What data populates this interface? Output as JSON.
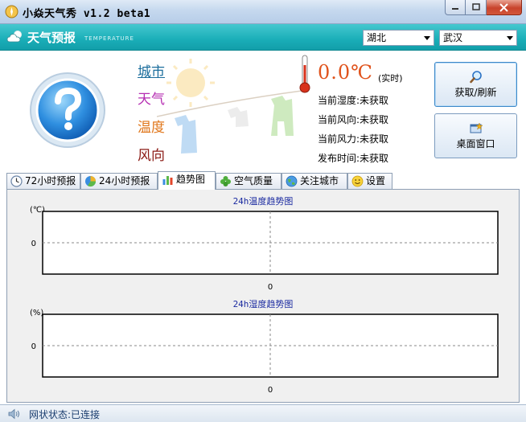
{
  "window": {
    "title": "小焱天气秀 v1.2 beta1",
    "icons": [
      "app-logo-icon",
      "minimize-icon",
      "maximize-icon",
      "close-icon"
    ]
  },
  "header": {
    "title": "天气预报",
    "subtitle": "TEMPERATURE",
    "province": "湖北",
    "city": "武汉"
  },
  "weather": {
    "labels": {
      "city": "城市",
      "weather": "天气",
      "temperature": "温度",
      "wind": "风向"
    },
    "temperature_value": "0.0℃",
    "realtime_label": "(实时)",
    "stats": [
      "当前湿度:未获取",
      "当前风向:未获取",
      "当前风力:未获取",
      "发布时间:未获取"
    ]
  },
  "buttons": {
    "refresh": "获取/刷新",
    "desktop": "桌面窗口"
  },
  "tabs": [
    {
      "label": "72小时预报",
      "icon": "clock-icon"
    },
    {
      "label": "24小时预报",
      "icon": "pie-chart-icon"
    },
    {
      "label": "趋势图",
      "icon": "bar-chart-icon",
      "active": true
    },
    {
      "label": "空气质量",
      "icon": "leaf-icon"
    },
    {
      "label": "关注城市",
      "icon": "globe-icon"
    },
    {
      "label": "设置",
      "icon": "smiley-icon"
    }
  ],
  "chart_data": [
    {
      "type": "line",
      "title": "24h温度趋势图",
      "ylabel": "(℃)",
      "yticks": [
        "0"
      ],
      "xticks": [
        "0"
      ],
      "series": [],
      "grid": "dashed crosshair at 0"
    },
    {
      "type": "line",
      "title": "24h湿度趋势图",
      "ylabel": "(%)",
      "yticks": [
        "0"
      ],
      "xticks": [
        "0"
      ],
      "series": [],
      "grid": "dashed crosshair at 0"
    }
  ],
  "status": {
    "text": "网状状态:已连接"
  },
  "colors": {
    "header_teal": "#1aaeb8",
    "temperature_orange": "#e0531c",
    "chart_title_blue": "#1a2aa0"
  }
}
